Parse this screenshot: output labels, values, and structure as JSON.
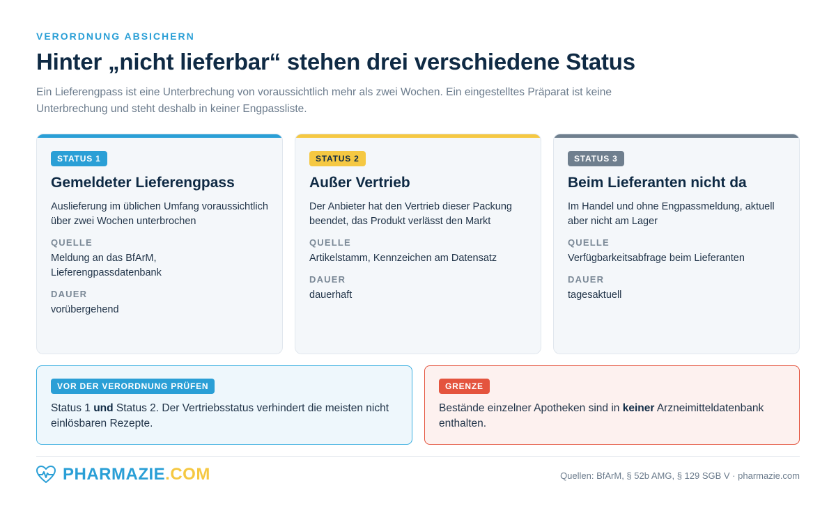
{
  "header": {
    "eyebrow": "VERORDNUNG ABSICHERN",
    "title": "Hinter „nicht lieferbar“ stehen drei verschiedene Status",
    "intro": "Ein Lieferengpass ist eine Unterbrechung von voraussichtlich mehr als zwei Wochen. Ein eingestelltes Präparat ist keine Unterbrechung und steht deshalb in keiner Engpassliste."
  },
  "cards": [
    {
      "badge": "STATUS 1",
      "accent": "#2a9fd6",
      "badge_text_color": "#ffffff",
      "title": "Gemeldeter Lieferengpass",
      "description": "Auslieferung im üblichen Umfang voraussichtlich über zwei Wochen unterbrochen",
      "source_label": "QUELLE",
      "source": "Meldung an das BfArM, Lieferengpassdatenbank",
      "duration_label": "DAUER",
      "duration": "vorübergehend"
    },
    {
      "badge": "STATUS 2",
      "accent": "#f5c842",
      "badge_text_color": "#0f2a44",
      "title": "Außer Vertrieb",
      "description": "Der Anbieter hat den Vertrieb dieser Packung beendet, das Produkt verlässt den Markt",
      "source_label": "QUELLE",
      "source": "Artikelstamm, Kennzeichen am Datensatz",
      "duration_label": "DAUER",
      "duration": "dauerhaft"
    },
    {
      "badge": "STATUS 3",
      "accent": "#6f7f8e",
      "badge_text_color": "#ffffff",
      "title": "Beim Lieferanten nicht da",
      "description": "Im Handel und ohne Engpassmeldung, aktuell aber nicht am Lager",
      "source_label": "QUELLE",
      "source": "Verfügbarkeitsabfrage beim Lieferanten",
      "duration_label": "DAUER",
      "duration": "tagesaktuell"
    }
  ],
  "notes": {
    "check": {
      "badge": "VOR DER VERORDNUNG PRÜFEN",
      "text_a": "Status 1 ",
      "text_bold": "und",
      "text_b": " Status 2. Der Vertriebsstatus verhindert die meisten nicht einlösbaren Rezepte."
    },
    "limit": {
      "badge": "GRENZE",
      "text_a": "Bestände einzelner Apotheken sind in ",
      "text_bold": "keiner",
      "text_b": " Arzneimitteldatenbank enthalten."
    }
  },
  "footer": {
    "brand_main": "PHARMAZIE",
    "brand_tld": ".COM",
    "sources": "Quellen: BfArM, § 52b AMG, § 129 SGB V · pharmazie.com",
    "logo_icon": "heart-pulse-icon"
  }
}
